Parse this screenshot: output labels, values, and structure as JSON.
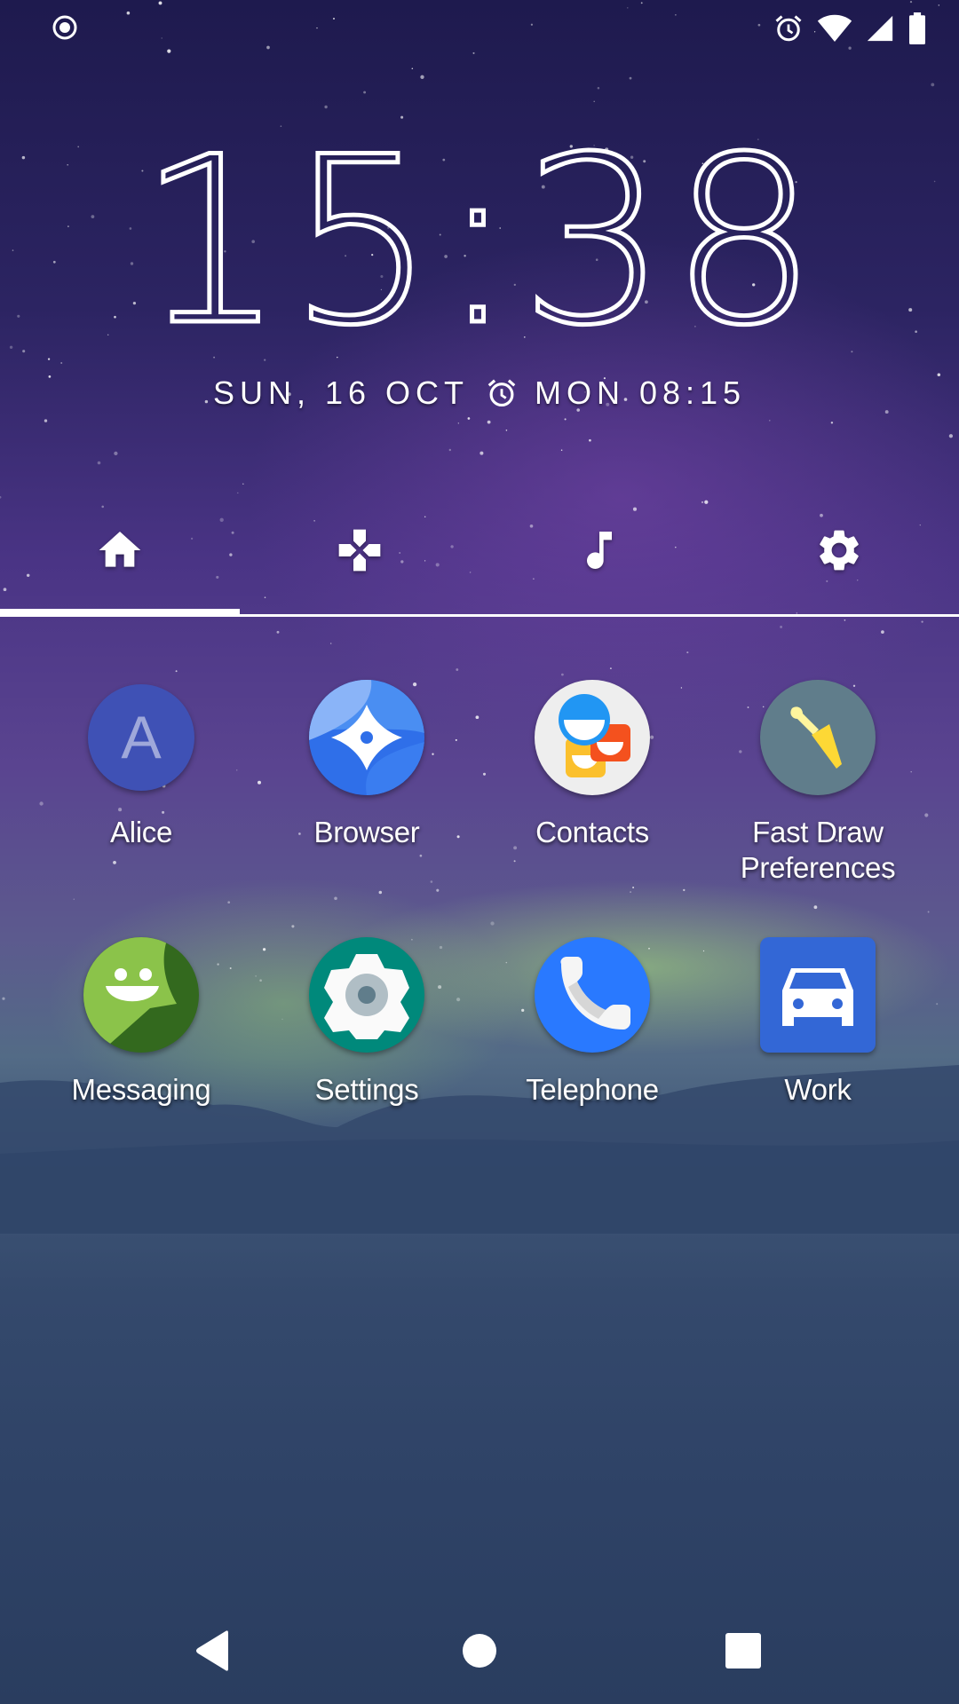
{
  "status_bar": {
    "left_icons": [
      "record-indicator-icon"
    ],
    "right_icons": [
      "alarm-icon",
      "wifi-icon",
      "cell-signal-icon",
      "battery-icon"
    ]
  },
  "clock": {
    "time": "15:38",
    "date": "SUN, 16 OCT",
    "next_alarm_icon": "alarm-icon",
    "next_alarm": "MON 08:15"
  },
  "tabs": {
    "selected_index": 0,
    "items": [
      {
        "name": "home",
        "icon": "home-icon"
      },
      {
        "name": "games",
        "icon": "gamepad-icon"
      },
      {
        "name": "music",
        "icon": "music-note-icon"
      },
      {
        "name": "settings",
        "icon": "gear-icon"
      }
    ]
  },
  "apps": [
    {
      "label": "Alice",
      "icon": "contact-letter-icon",
      "letter": "A",
      "color": "#3f51b5"
    },
    {
      "label": "Browser",
      "icon": "browser-compass-icon",
      "color": "#4285f4"
    },
    {
      "label": "Contacts",
      "icon": "contacts-icon",
      "color": "#eeeeee"
    },
    {
      "label": "Fast Draw Preferences",
      "label_lines": [
        "Fast Draw",
        "Preferences"
      ],
      "icon": "wrench-brush-icon",
      "color": "#607d8b"
    },
    {
      "label": "Messaging",
      "icon": "messaging-smiley-icon",
      "color": "#8bc34a"
    },
    {
      "label": "Settings",
      "icon": "settings-gear-icon",
      "color": "#00897b"
    },
    {
      "label": "Telephone",
      "icon": "phone-handset-icon",
      "color": "#2979ff"
    },
    {
      "label": "Work",
      "icon": "car-icon",
      "color": "#3367d6"
    }
  ],
  "nav_bar": {
    "items": [
      {
        "name": "back",
        "icon": "back-triangle-icon"
      },
      {
        "name": "home",
        "icon": "home-circle-icon"
      },
      {
        "name": "recents",
        "icon": "recents-square-icon"
      }
    ]
  }
}
